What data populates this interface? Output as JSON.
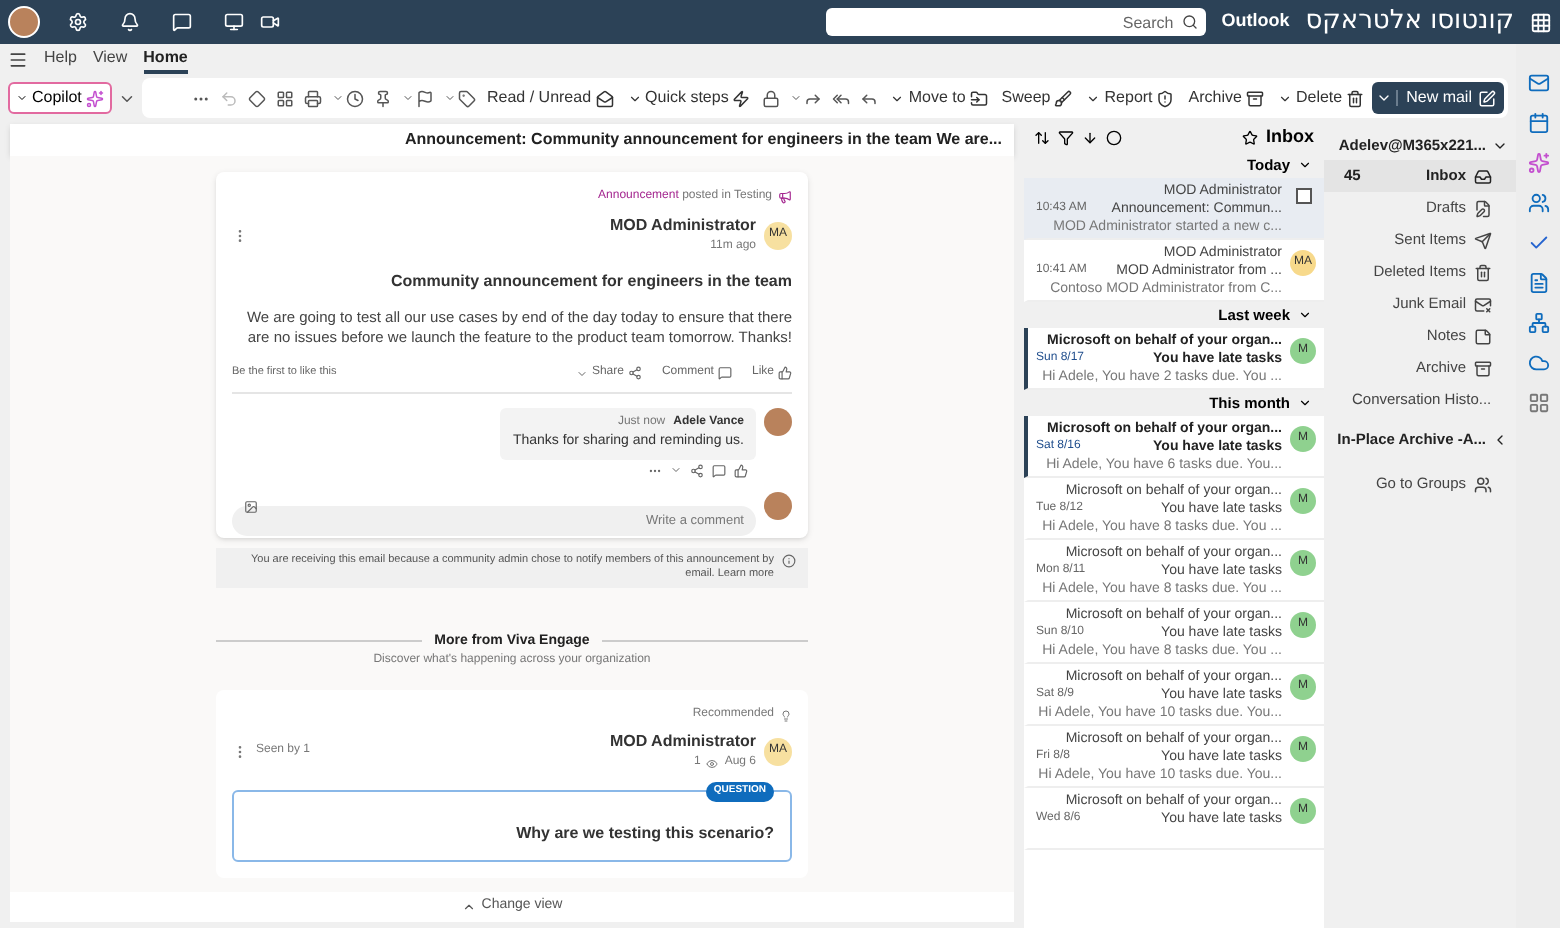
{
  "top_bar": {
    "app_title": "קונטוסו אלטראקס",
    "product": "Outlook",
    "search": {
      "placeholder": "Search"
    }
  },
  "ribbon": {
    "tabs": [
      {
        "label": "Help",
        "selected": false
      },
      {
        "label": "View",
        "selected": false
      },
      {
        "label": "Home",
        "selected": true
      }
    ],
    "tools": [
      {
        "label": "Read / Unread"
      },
      {
        "label": "Quick steps"
      },
      {
        "label": "Move to"
      },
      {
        "label": "Sweep"
      },
      {
        "label": "Report"
      },
      {
        "label": "Archive"
      },
      {
        "label": "Delete"
      },
      {
        "label": "New mail"
      }
    ],
    "copilot": "Copilot"
  },
  "folders": {
    "account": {
      "label": "Adelev@M365x221...",
      "expanded": true
    },
    "items": [
      {
        "label": "Inbox",
        "count": "45",
        "selected": true
      },
      {
        "label": "Drafts",
        "selected": false
      },
      {
        "label": "Sent Items",
        "selected": false
      },
      {
        "label": "Deleted Items",
        "selected": false
      },
      {
        "label": "Junk Email",
        "selected": false
      },
      {
        "label": "Notes",
        "selected": false
      },
      {
        "label": "Archive",
        "selected": false
      },
      {
        "label": "Conversation Histo...",
        "selected": false
      }
    ],
    "archive_account": {
      "label": "In-Place Archive -A...",
      "expanded": false
    },
    "groups_link": "Go to Groups"
  },
  "message_list": {
    "title": "Inbox",
    "groups": [
      {
        "label": "Today",
        "expanded": true,
        "messages": [
          {
            "kind": "checkbox",
            "checked": false,
            "sender": "MOD Administrator",
            "subject": "Announcement: Commun...",
            "time": "10:43 AM",
            "preview": "MOD Administrator started a new c...",
            "unread": false,
            "selected": true
          },
          {
            "kind": "avatar",
            "initials": "MA",
            "color": "#f7d98b",
            "sender": "MOD Administrator",
            "subject": "MOD Administrator from ...",
            "time": "10:41 AM",
            "preview": "Contoso MOD Administrator from C...",
            "unread": false,
            "selected": false
          }
        ]
      },
      {
        "label": "Last week",
        "expanded": true,
        "messages": [
          {
            "kind": "avatar",
            "initials": "M",
            "color": "#8fd18f",
            "sender": "Microsoft on behalf of your organ...",
            "subject": "You have late tasks",
            "time": "Sun 8/17",
            "preview": "Hi Adele, You have 2 tasks due. You ...",
            "unread": true,
            "selected": false
          }
        ]
      },
      {
        "label": "This month",
        "expanded": true,
        "messages": [
          {
            "kind": "avatar",
            "initials": "M",
            "color": "#8fd18f",
            "sender": "Microsoft on behalf of your organ...",
            "subject": "You have late tasks",
            "time": "Sat 8/16",
            "preview": "Hi Adele, You have 6 tasks due. You...",
            "unread": true,
            "selected": false
          },
          {
            "kind": "avatar",
            "initials": "M",
            "color": "#8fd18f",
            "sender": "Microsoft on behalf of your organ...",
            "subject": "You have late tasks",
            "time": "Tue 8/12",
            "preview": "Hi Adele, You have 8 tasks due. You ...",
            "unread": false,
            "selected": false
          },
          {
            "kind": "avatar",
            "initials": "M",
            "color": "#8fd18f",
            "sender": "Microsoft on behalf of your organ...",
            "subject": "You have late tasks",
            "time": "Mon 8/11",
            "preview": "Hi Adele, You have 8 tasks due. You ...",
            "unread": false,
            "selected": false
          },
          {
            "kind": "avatar",
            "initials": "M",
            "color": "#8fd18f",
            "sender": "Microsoft on behalf of your organ...",
            "subject": "You have late tasks",
            "time": "Sun 8/10",
            "preview": "Hi Adele, You have 8 tasks due. You ...",
            "unread": false,
            "selected": false
          },
          {
            "kind": "avatar",
            "initials": "M",
            "color": "#8fd18f",
            "sender": "Microsoft on behalf of your organ...",
            "subject": "You have late tasks",
            "time": "Sat 8/9",
            "preview": "Hi Adele, You have 10 tasks due. You...",
            "unread": false,
            "selected": false
          },
          {
            "kind": "avatar",
            "initials": "M",
            "color": "#8fd18f",
            "sender": "Microsoft on behalf of your organ...",
            "subject": "You have late tasks",
            "time": "Fri 8/8",
            "preview": "Hi Adele, You have 10 tasks due. You...",
            "unread": false,
            "selected": false
          },
          {
            "kind": "avatar",
            "initials": "M",
            "color": "#8fd18f",
            "sender": "Microsoft on behalf of your organ...",
            "subject": "You have late tasks",
            "time": "Wed 8/6",
            "unread": false,
            "selected": false
          }
        ]
      }
    ]
  },
  "reading": {
    "subject": "Announcement: Community announcement for engineers in the team We are...",
    "post": {
      "tag": "Announcement",
      "tag_rest": "posted in Testing",
      "initials": "MA",
      "author": "MOD Administrator",
      "time": "11m ago",
      "title": "Community announcement for engineers in the team",
      "body": "We are going to test all our use cases by end of the day today to ensure that there are no issues before we launch the feature to the product team tomorrow. Thanks!",
      "actions": [
        "Share",
        "Comment",
        "Like"
      ],
      "like_note": "Be the first to like this"
    },
    "comment": {
      "author": "Adele Vance",
      "time": "Just now",
      "text": "Thanks for sharing and reminding us."
    },
    "comment_field": {
      "placeholder": "Write a comment"
    },
    "notice": {
      "text": "You are receiving this email because a community admin chose to notify members of this announcement by email.",
      "link": "Learn more"
    },
    "more": {
      "title": "More from Viva Engage",
      "subtitle": "Discover what's happening across your organization"
    },
    "recommended": {
      "label": "Recommended",
      "initials": "MA",
      "author": "MOD Administrator",
      "date": "Aug 6",
      "views": "1",
      "seen": "Seen by 1",
      "badge": "QUESTION",
      "question": "Why are we testing this scenario?"
    },
    "change_view": "Change view"
  }
}
